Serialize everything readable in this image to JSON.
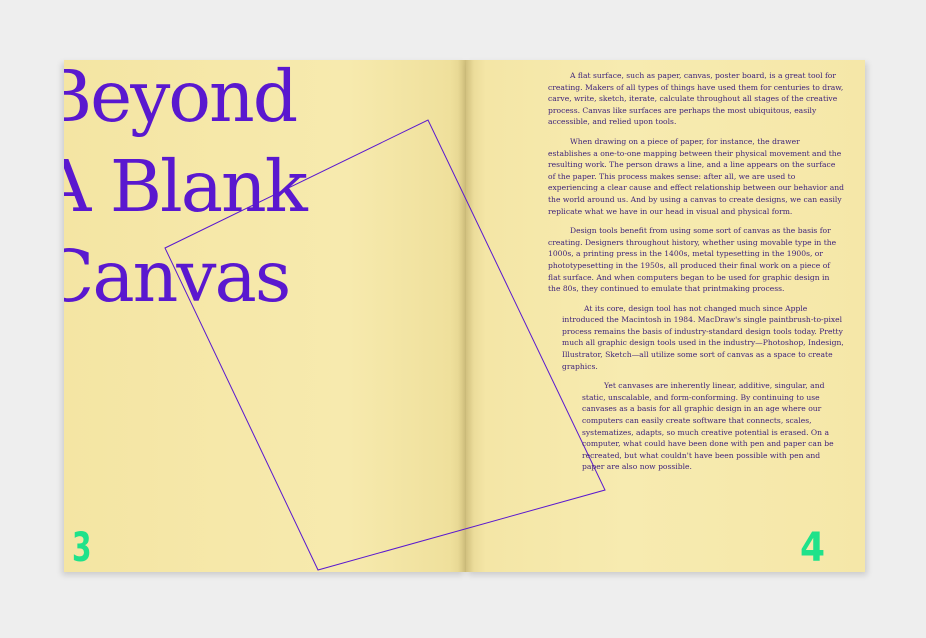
{
  "spread": {
    "title_lines": [
      "Beyond",
      "A Blank",
      "Canvas"
    ],
    "paragraphs": [
      "A flat surface, such as paper, canvas, poster board, is a great tool for creating. Makers of all types of things have used them for centuries to draw, carve, write, sketch, iterate, calculate throughout all stages of the creative process. Canvas like surfaces are perhaps the most ubiquitous, easily accessible, and relied upon tools.",
      "When drawing on a piece of paper, for instance, the drawer establishes a one-to-one mapping between their physical movement and the resulting work. The person draws a line, and a line appears on the surface of the paper. This process makes sense: after all, we are used to experiencing a clear cause and effect relationship between our behavior and the world around us. And by using a canvas to create designs, we can easily replicate what we have in our head in visual and physical form.",
      "Design tools benefit from using some sort of canvas as the basis for creating. Designers throughout history, whether using movable type in the 1000s, a printing press in the 1400s, metal typesetting in the 1900s, or phototypesetting in the 1950s, all produced their final work on a piece of flat surface. And when computers began to be used for graphic design in the 80s, they continued to emulate that printmaking process.",
      "At its core, design tool has not changed much since Apple introduced the Macintosh in 1984. MacDraw's single paintbrush-to-pixel process remains the basis of industry-standard design tools today. Pretty much all graphic design tools used in the industry—Photoshop, Indesign, Illustrator, Sketch—all utilize some sort of canvas as a space to create graphics.",
      "Yet canvases are inherently linear, additive, singular, and static, unscalable, and form-conforming. By continuing to use canvases as a basis for all graphic design in an age where our computers can easily create software that connects, scales, systematizes, adapts, so much creative potential is erased. On a computer, what could have been done with pen and paper can be recreated, but what couldn't have been possible with pen and paper are also now possible."
    ],
    "page_left_number": "3",
    "page_right_number": "4"
  },
  "colors": {
    "title": "#5a18cf",
    "body_text": "#3b1f7a",
    "page_number": "#1fe28a",
    "paper": "#f6e8a8",
    "background": "#eeeeee"
  }
}
